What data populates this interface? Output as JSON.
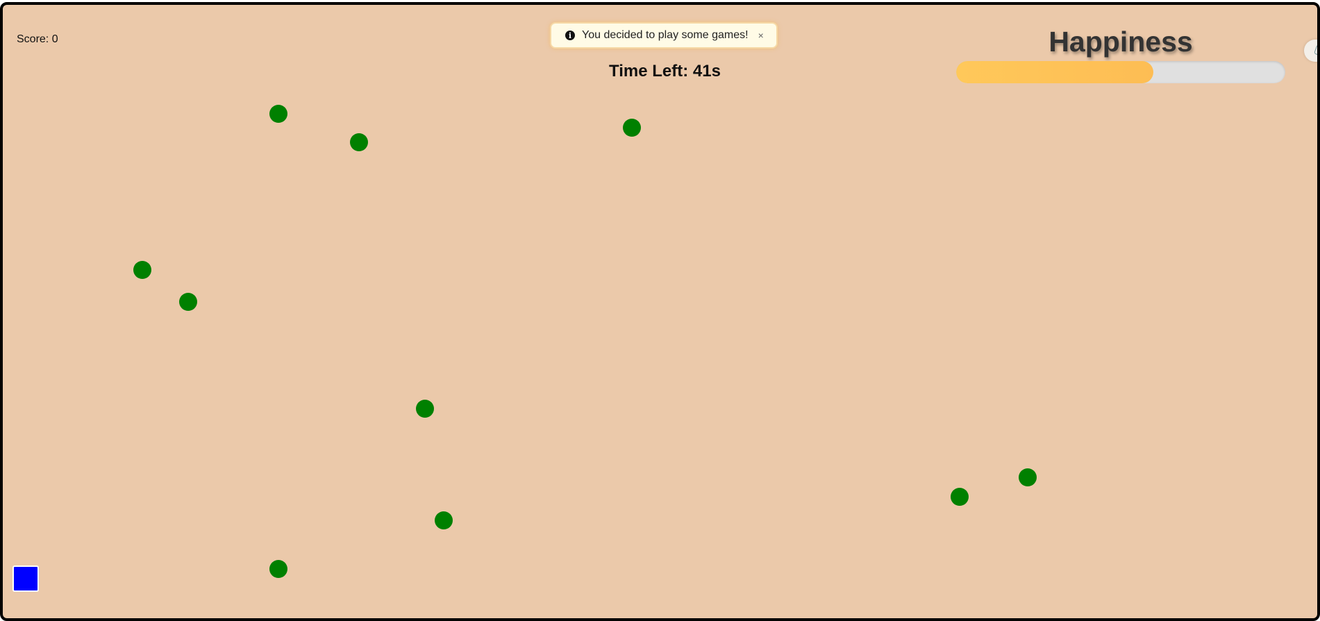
{
  "score_text": "Score: 0",
  "toast": {
    "icon": "info-icon",
    "message": "You decided to play some games!",
    "close_label": "×"
  },
  "timer_text": "Time Left: 41s",
  "happiness": {
    "title": "Happiness",
    "level": 0.6,
    "fill_color": "#fdbd54",
    "track_color": "#e0e0e0"
  },
  "side_tab": {
    "icon": "layers-icon"
  },
  "game": {
    "background_color": "#ebc9aa",
    "target_color": "#008000",
    "player_color": "#0000ff",
    "target_count": 11
  }
}
